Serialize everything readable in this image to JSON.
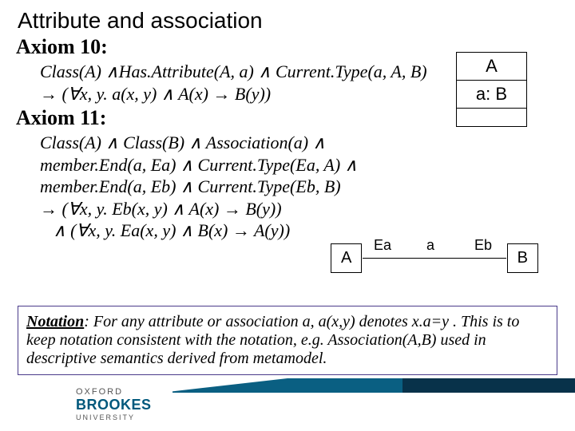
{
  "title": "Attribute and association",
  "axiom10": {
    "heading": "Axiom 10:",
    "line1": "Class(A) ∧Has.Attribute(A, a) ∧ Current.Type(a, A, B)",
    "line2": "→ (∀x, y. a(x, y) ∧ A(x) → B(y))"
  },
  "axiom11": {
    "heading": "Axiom 11:",
    "line1": "Class(A) ∧ Class(B) ∧ Association(a) ∧",
    "line2": "member.End(a, Ea) ∧ Current.Type(Ea, A) ∧",
    "line3": "member.End(a, Eb) ∧ Current.Type(Eb, B)",
    "line4": "→ (∀x, y. Eb(x, y) ∧ A(x) → B(y))",
    "line5": "   ∧ (∀x, y. Ea(x, y) ∧ B(x) → A(y))"
  },
  "classBox": {
    "name": "A",
    "attr": "a: B"
  },
  "assoc": {
    "A": "A",
    "B": "B",
    "Ea": "Ea",
    "a": "a",
    "Eb": "Eb"
  },
  "notation": "Notation: For any attribute or association a, a(x,y) denotes  x.a=y . This is to keep notation consistent with the notation, e.g. Association(A,B) used in descriptive semantics derived from metamodel.",
  "logo": {
    "l1": "OXFORD",
    "l2": "BROOKES",
    "l3": "UNIVERSITY"
  }
}
